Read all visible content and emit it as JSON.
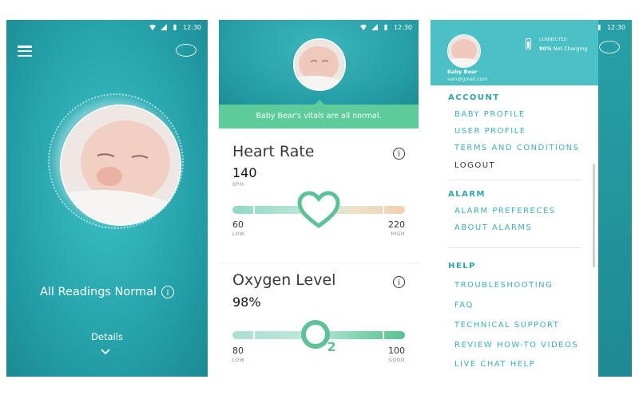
{
  "status_bar": {
    "time": "12:30"
  },
  "home": {
    "status_text": "All Readings Normal",
    "info_glyph": "i",
    "details_label": "Details",
    "icons": [
      "menu-icon",
      "device-icon",
      "info-icon",
      "chevron-down-icon"
    ]
  },
  "vitals": {
    "banner": "Baby Bear's vitals are all normal.",
    "heart_rate": {
      "title": "Heart Rate",
      "value": "140",
      "unit": "BPM",
      "low_value": "60",
      "low_label": "LOW",
      "high_value": "220",
      "high_label": "HIGH",
      "level_fraction": 0.5
    },
    "oxygen": {
      "title": "Oxygen Level",
      "value": "98%",
      "low_value": "80",
      "low_label": "LOW",
      "high_value": "100",
      "high_label": "GOOD",
      "level_fraction": 0.48,
      "icon_text": "O",
      "icon_sub": "2"
    },
    "colors": {
      "accent": "#5dcc9a",
      "teal": "#27a4ac"
    }
  },
  "drawer": {
    "profile_name": "Baby Bear",
    "profile_email": "sam@gmail.com",
    "connection_status": "CONNECTED",
    "battery_percent": "80%",
    "battery_status": "Not Charging",
    "sections": [
      {
        "title": "ACCOUNT",
        "items": [
          "BABY PROFILE",
          "USER PROFILE",
          "TERMS AND CONDITIONS",
          "LOGOUT"
        ]
      },
      {
        "title": "ALARM",
        "items": [
          "ALARM PREFERECES",
          "ABOUT ALARMS"
        ]
      },
      {
        "title": "HELP",
        "items": [
          "TROUBLESHOOTING",
          "FAQ",
          "TECHNICAL SUPPORT",
          "REVIEW HOW-TO VIDEOS",
          "LIVE CHAT HELP"
        ]
      }
    ]
  }
}
